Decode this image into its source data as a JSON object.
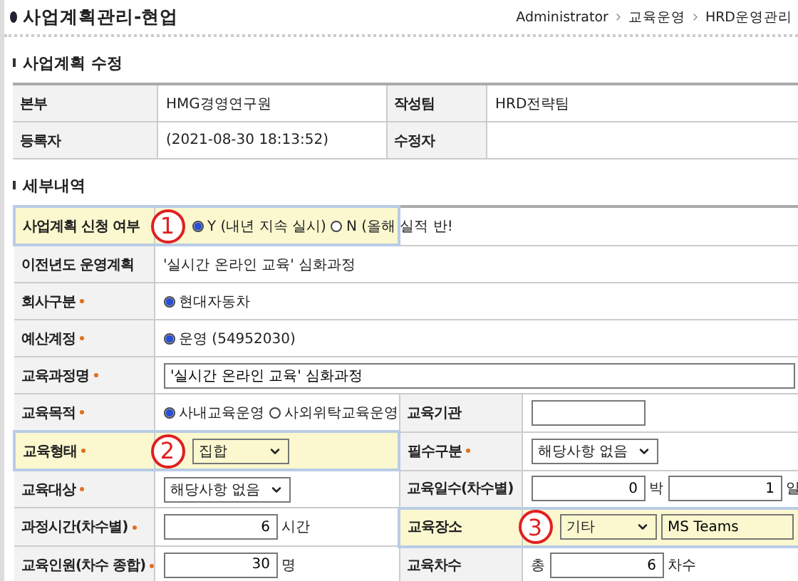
{
  "header": {
    "title": "사업계획관리-현업",
    "breadcrumb": [
      "Administrator",
      "교육운영",
      "HRD운영관리"
    ]
  },
  "section_title": "사업계획 수정",
  "info_rows": [
    {
      "label": "본부",
      "value": "HMG경영연구원",
      "label2": "작성팀",
      "value2": "HRD전략팀"
    },
    {
      "label": "등록자",
      "value": "(2021-08-30 18:13:52)",
      "label2": "수정자",
      "value2": ""
    }
  ],
  "details_title": "세부내역",
  "rows": [
    {
      "fields": [
        {
          "label": "사업계획 신청 여부",
          "required": false,
          "highlighted": true,
          "marker": "1",
          "parts": [
            {
              "kind": "radio",
              "label": "Y (내년 지속 실시)",
              "selected": true
            },
            {
              "kind": "radio",
              "label": "N (올해 실적 반!",
              "selected": false
            }
          ]
        }
      ]
    },
    {
      "fields": [
        {
          "label": "이전년도 운영계획",
          "required": false,
          "highlighted": false,
          "parts": [
            {
              "kind": "text",
              "text": "'실시간 온라인 교육' 심화과정"
            }
          ]
        }
      ]
    },
    {
      "fields": [
        {
          "label": "회사구분",
          "required": true,
          "highlighted": false,
          "parts": [
            {
              "kind": "radio",
              "label": "현대자동차",
              "selected": true
            }
          ]
        }
      ]
    },
    {
      "fields": [
        {
          "label": "예산계정",
          "required": true,
          "highlighted": false,
          "parts": [
            {
              "kind": "radio",
              "label": "운영 (54952030)",
              "selected": true
            }
          ]
        }
      ]
    },
    {
      "fields": [
        {
          "label": "교육과정명",
          "required": true,
          "highlighted": false,
          "parts": [
            {
              "kind": "input",
              "value": "'실시간 온라인 교육' 심화과정"
            }
          ]
        }
      ]
    },
    {
      "fields": [
        {
          "label": "교육목적",
          "required": true,
          "highlighted": false,
          "parts": [
            {
              "kind": "radio",
              "label": "사내교육운영",
              "selected": true
            },
            {
              "kind": "radio",
              "label": "사외위탁교육운영",
              "selected": false
            }
          ]
        },
        {
          "label": "교육기관",
          "required": false,
          "highlighted": false,
          "parts": [
            {
              "kind": "number"
            }
          ]
        }
      ]
    },
    {
      "fields": [
        {
          "label": "교육형태",
          "required": true,
          "highlighted": true,
          "marker": "2",
          "parts": [
            {
              "kind": "select",
              "value": "집합"
            }
          ]
        },
        {
          "label": "필수구분",
          "required": true,
          "highlighted": false,
          "parts": [
            {
              "kind": "select",
              "value": "해당사항 없음"
            }
          ]
        }
      ]
    },
    {
      "fields": [
        {
          "label": "교육대상",
          "required": true,
          "highlighted": false,
          "parts": [
            {
              "kind": "select",
              "value": "해당사항 없음"
            }
          ]
        },
        {
          "label": "교육일수(차수별)",
          "required": false,
          "highlighted": false,
          "parts": [
            {
              "kind": "number",
              "value": "0"
            },
            {
              "kind": "unit",
              "text": "박"
            },
            {
              "kind": "number",
              "value": "1"
            },
            {
              "kind": "unit",
              "text": "일"
            }
          ]
        }
      ]
    },
    {
      "fields": [
        {
          "label": "과정시간(차수별)",
          "required": true,
          "highlighted": false,
          "parts": [
            {
              "kind": "number",
              "value": "6"
            },
            {
              "kind": "unit",
              "text": "시간"
            }
          ]
        },
        {
          "label": "교육장소",
          "required": false,
          "highlighted": true,
          "marker": "3",
          "parts": [
            {
              "kind": "select",
              "value": "기타"
            },
            {
              "kind": "input",
              "value": "MS Teams"
            }
          ]
        }
      ]
    },
    {
      "fields": [
        {
          "label": "교육인원(차수 종합)",
          "required": true,
          "highlighted": false,
          "parts": [
            {
              "kind": "number",
              "value": "30"
            },
            {
              "kind": "unit",
              "text": "명"
            }
          ]
        },
        {
          "label": "교육차수",
          "required": false,
          "highlighted": false,
          "parts": [
            {
              "kind": "unit",
              "text": "총"
            },
            {
              "kind": "number",
              "value": "6"
            },
            {
              "kind": "unit",
              "text": "차수"
            }
          ]
        }
      ]
    }
  ]
}
